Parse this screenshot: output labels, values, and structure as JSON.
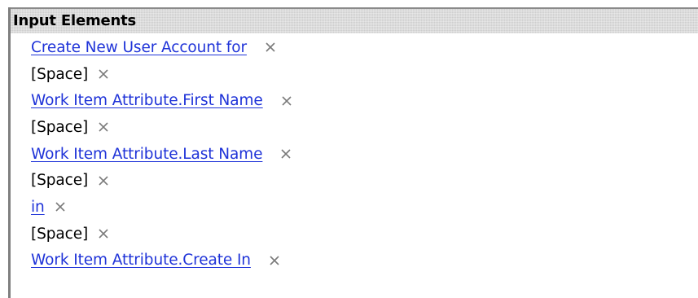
{
  "panel": {
    "title": "Input Elements"
  },
  "items": [
    {
      "kind": "link",
      "label": "Create New User Account for"
    },
    {
      "kind": "text",
      "label": "[Space]"
    },
    {
      "kind": "link",
      "label": "Work Item Attribute.First Name"
    },
    {
      "kind": "text",
      "label": "[Space]"
    },
    {
      "kind": "link",
      "label": "Work Item Attribute.Last Name"
    },
    {
      "kind": "text",
      "label": "[Space]"
    },
    {
      "kind": "link",
      "label": "in"
    },
    {
      "kind": "text",
      "label": "[Space]"
    },
    {
      "kind": "link",
      "label": "Work Item Attribute.Create In"
    }
  ],
  "icons": {
    "remove": "close-icon"
  },
  "colors": {
    "link": "#1f33d8",
    "header_bg": "#dcdcdc",
    "border": "#7f7f7f",
    "remove_icon": "#7a7a7a"
  }
}
